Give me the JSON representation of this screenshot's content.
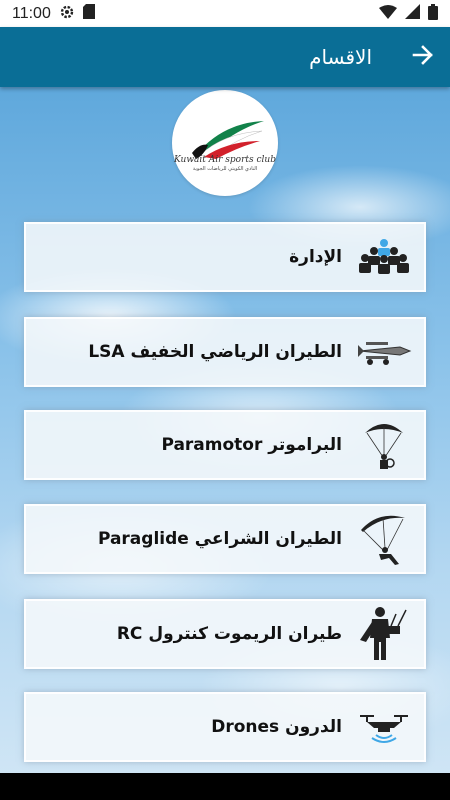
{
  "status_bar": {
    "time": "11:00"
  },
  "app_bar": {
    "title": "الاقسام",
    "back_icon": "arrow-right-icon"
  },
  "logo": {
    "text": "Kuwait Air sports club",
    "subtext": "النادي الكويتي للرياضات الجوية"
  },
  "sections": [
    {
      "label": "الإدارة",
      "icon": "management-group-icon"
    },
    {
      "label": "الطيران الرياضي الخفيف LSA",
      "icon": "light-aircraft-icon"
    },
    {
      "label": "البراموتر Paramotor",
      "icon": "paramotor-icon"
    },
    {
      "label": "الطيران الشراعي Paraglide",
      "icon": "paraglider-icon"
    },
    {
      "label": "طيران الريموت كنترول RC",
      "icon": "rc-pilot-icon"
    },
    {
      "label": "الدرون Drones",
      "icon": "drone-icon"
    }
  ],
  "colors": {
    "app_bar": "#0a6e96",
    "card_bg": "#f5f8fa",
    "sky": "#8cc3ea"
  }
}
